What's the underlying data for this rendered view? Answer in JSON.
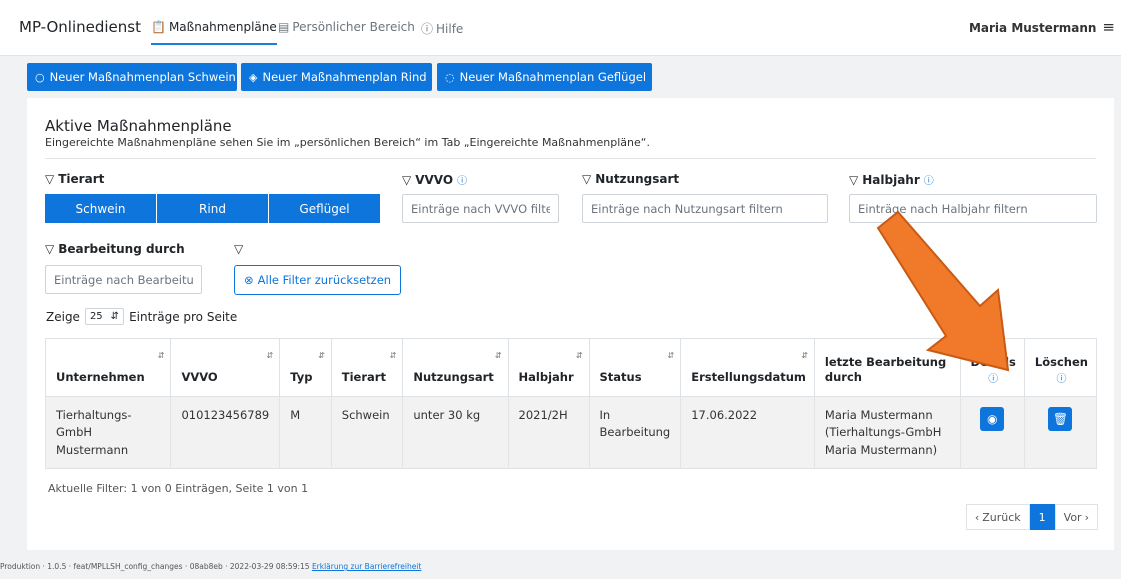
{
  "nav": {
    "brand": "MP-Onlinedienst",
    "items": [
      {
        "label": "Maßnahmenpläne",
        "icon": "clipboard-icon"
      },
      {
        "label": "Persönlicher Bereich",
        "icon": "id-card-icon"
      },
      {
        "label": "Hilfe",
        "icon": "question-circle-icon"
      }
    ],
    "user": "Maria Mustermann",
    "menu_icon": "≡"
  },
  "actions": {
    "schwein": "Neuer Maßnahmenplan Schwein",
    "rind": "Neuer Maßnahmenplan Rind",
    "gefluegel": "Neuer Maßnahmenplan Geflügel"
  },
  "card": {
    "title": "Aktive Maßnahmenpläne",
    "subtitle": "Eingereichte Maßnahmenpläne sehen Sie im „persönlichen Bereich“ im Tab „Eingereichte Maßnahmenpläne“."
  },
  "filters": {
    "tierart": {
      "label": "Tierart",
      "options": [
        "Schwein",
        "Rind",
        "Geflügel"
      ]
    },
    "vvvo": {
      "label": "VVVO",
      "placeholder": "Einträge nach VVVO filtern"
    },
    "nutzungsart": {
      "label": "Nutzungsart",
      "placeholder": "Einträge nach Nutzungsart filtern"
    },
    "halbjahr": {
      "label": "Halbjahr",
      "placeholder": "Einträge nach Halbjahr filtern"
    },
    "bearbeitung": {
      "label": "Bearbeitung durch",
      "placeholder": "Einträge nach Bearbeitung durch filtern"
    },
    "reset_label": "Alle Filter zurücksetzen"
  },
  "length": {
    "prefix": "Zeige",
    "value": "25",
    "suffix": "Einträge pro Seite"
  },
  "table": {
    "headers": [
      "Unternehmen",
      "VVVO",
      "Typ",
      "Tierart",
      "Nutzungsart",
      "Halbjahr",
      "Status",
      "Erstellungsdatum",
      "letzte Bearbeitung durch",
      "Details",
      "Löschen"
    ],
    "rows": [
      {
        "unternehmen": "Tierhaltungs-GmbH Mustermann",
        "vvvo": "010123456789",
        "typ": "M",
        "tierart": "Schwein",
        "nutzungsart": "unter 30 kg",
        "halbjahr": "2021/2H",
        "status": "In Bearbeitung",
        "erstellungsdatum": "17.06.2022",
        "letzte_bearbeitung": "Maria Mustermann (Tierhaltungs-GmbH Maria Mustermann)"
      }
    ]
  },
  "info": "Aktuelle Filter: 1 von 0 Einträgen, Seite 1 von 1",
  "pager": {
    "prev": "Zurück",
    "page": "1",
    "next": "Vor"
  },
  "footer": {
    "text": "Produktion · 1.0.5 · feat/MPLLSH_config_changes · 08ab8eb · 2022-03-29 08:59:15",
    "link": "Erklärung zur Barrierefreiheit"
  },
  "colors": {
    "primary": "#0d75dc",
    "arrow": "#f07a2a"
  }
}
